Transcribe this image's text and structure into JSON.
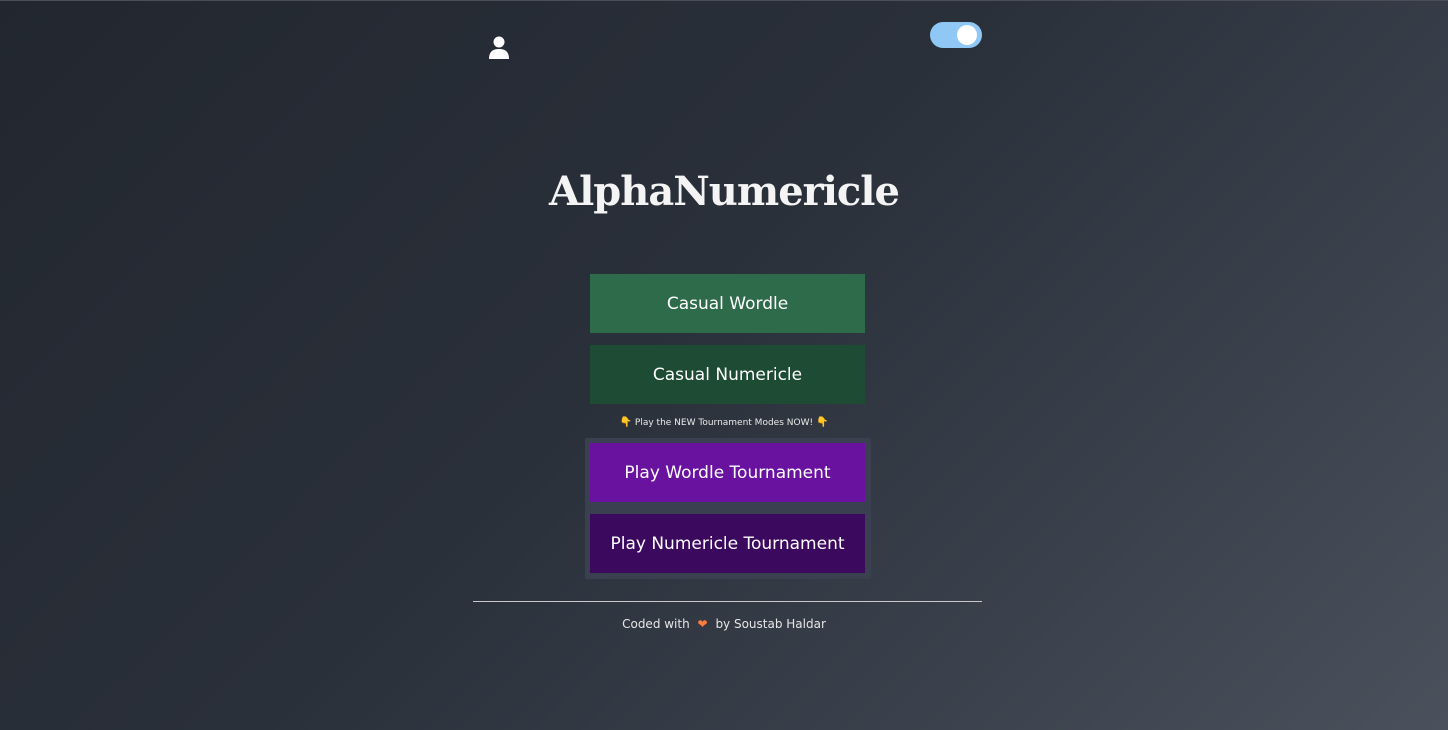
{
  "app": {
    "title": "AlphaNumericle"
  },
  "header": {
    "user_icon": "user-icon",
    "theme_toggle": {
      "state": "on",
      "track_color": "#8fc8f5"
    }
  },
  "modes": {
    "casual_wordle": "Casual Wordle",
    "casual_numericle": "Casual Numericle",
    "promo_text": "Play the NEW Tournament Modes NOW!",
    "promo_icon": "👇",
    "tournament_wordle": "Play Wordle Tournament",
    "tournament_numericle": "Play Numericle Tournament"
  },
  "colors": {
    "casual_wordle": "#2e6b4b",
    "casual_numericle": "#1d4b34",
    "tournament_wordle": "#6a12a0",
    "tournament_numericle": "#3b0a5e"
  },
  "footer": {
    "prefix": "Coded with",
    "heart": "❤",
    "suffix": "by Soustab Haldar"
  }
}
